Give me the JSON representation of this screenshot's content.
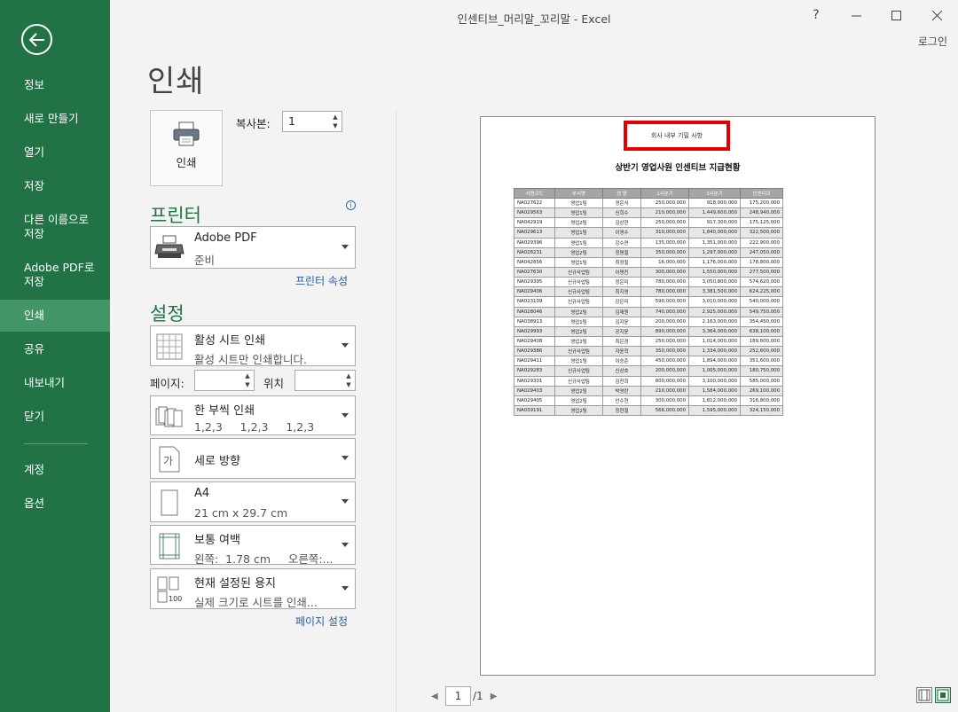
{
  "window": {
    "title": "인센티브_머리말_꼬리말 - Excel",
    "help": "?",
    "minimize": "—",
    "maximize": "☐",
    "close": "✕",
    "login": "로그인"
  },
  "sidebar": {
    "back_icon": "arrow-left-icon",
    "items": [
      {
        "label": "정보"
      },
      {
        "label": "새로 만들기"
      },
      {
        "label": "열기"
      },
      {
        "label": "저장"
      },
      {
        "label": "다른 이름으로\n저장"
      },
      {
        "label": "Adobe PDF로\n저장"
      },
      {
        "label": "인쇄",
        "active": true
      },
      {
        "label": "공유"
      },
      {
        "label": "내보내기"
      },
      {
        "label": "닫기"
      },
      {
        "label": "계정"
      },
      {
        "label": "옵션"
      }
    ]
  },
  "print": {
    "page_title": "인쇄",
    "print_button": "인쇄",
    "copies_label": "복사본:",
    "copies_value": "1",
    "printer_heading": "프린터",
    "printer_name": "Adobe PDF",
    "printer_status": "준비",
    "printer_props": "프린터 속성",
    "settings_heading": "설정",
    "scope_title": "활성 시트 인쇄",
    "scope_sub": "활성 시트만 인쇄합니다.",
    "pages_label": "페이지:",
    "to_label": "위치",
    "collate_title": "한 부씩 인쇄",
    "collate_sub": "1,2,3     1,2,3     1,2,3",
    "orientation": "세로 방향",
    "paper_title": "A4",
    "paper_sub": "21 cm x 29.7 cm",
    "margin_title": "보통 여백",
    "margin_sub": "왼쪽:  1.78 cm     오른쪽:...",
    "scale_title": "현재 설정된 용지",
    "scale_sub": "실제 크기로 시트를 인쇄...",
    "page_setup": "페이지 설정"
  },
  "preview": {
    "header_text": "회사 내부 기밀 사항",
    "title": "상반기 영업사원 인센티브 지급현황",
    "columns": [
      "사원코드",
      "부서명",
      "성 명",
      "1사분기",
      "2사분기",
      "인센티브"
    ],
    "rows": [
      [
        "NA027622",
        "영업1팀",
        "경은식",
        "250,000,000",
        "918,000,000",
        "175,200,000"
      ],
      [
        "NA029563",
        "영업1팀",
        "신희수",
        "210,000,000",
        "1,449,600,000",
        "248,940,000"
      ],
      [
        "NA042919",
        "영업2팀",
        "김상현",
        "250,000,000",
        "917,300,000",
        "175,125,000"
      ],
      [
        "NA029613",
        "영업1팀",
        "이영수",
        "310,000,000",
        "1,840,000,000",
        "322,500,000"
      ],
      [
        "NA029396",
        "영업1팀",
        "강수연",
        "135,000,000",
        "1,351,000,000",
        "222,900,000"
      ],
      [
        "NA028231",
        "영업2팀",
        "정명철",
        "350,000,000",
        "1,297,000,000",
        "247,050,000"
      ],
      [
        "NA042856",
        "영업1팀",
        "최정철",
        "16,000,000",
        "1,176,000,000",
        "178,800,000"
      ],
      [
        "NA027630",
        "신규사업팀",
        "이명진",
        "300,000,000",
        "1,550,000,000",
        "277,500,000"
      ],
      [
        "NA029395",
        "신규사업팀",
        "정은미",
        "780,000,000",
        "3,050,800,000",
        "574,620,000"
      ],
      [
        "NA029406",
        "신규사업팀",
        "최지영",
        "780,000,000",
        "3,381,500,000",
        "624,225,000"
      ],
      [
        "NA023109",
        "신규사업팀",
        "강은미",
        "590,000,000",
        "3,010,000,000",
        "540,000,000"
      ],
      [
        "NA028046",
        "영업2팀",
        "김재원",
        "740,000,000",
        "2,925,000,000",
        "549,750,000"
      ],
      [
        "NA038913",
        "영업1팀",
        "김지윤",
        "200,000,000",
        "2,163,000,000",
        "354,450,000"
      ],
      [
        "NA029993",
        "영업2팀",
        "공지윤",
        "890,000,000",
        "3,364,000,000",
        "638,100,000"
      ],
      [
        "NA029408",
        "영업2팀",
        "최은경",
        "250,000,000",
        "1,014,000,000",
        "189,600,000"
      ],
      [
        "NA029386",
        "신규사업팀",
        "자윤혁",
        "350,000,000",
        "1,334,000,000",
        "252,600,000"
      ],
      [
        "NA029411",
        "영업1팀",
        "이승준",
        "450,000,000",
        "1,894,000,000",
        "351,600,000"
      ],
      [
        "NA029283",
        "신규사업팀",
        "신상호",
        "200,000,000",
        "1,005,000,000",
        "180,750,000"
      ],
      [
        "NA029301",
        "신규사업팀",
        "김진희",
        "800,000,000",
        "3,100,000,000",
        "585,000,000"
      ],
      [
        "NA029403",
        "영업2팀",
        "박영란",
        "210,000,000",
        "1,584,000,000",
        "269,100,000"
      ],
      [
        "NA029405",
        "영업2팀",
        "안수현",
        "300,000,000",
        "1,812,000,000",
        "316,800,000"
      ],
      [
        "NA039191",
        "영업2팀",
        "정현철",
        "566,000,000",
        "1,595,000,000",
        "324,150,000"
      ]
    ],
    "page_current": "1",
    "page_total": "/1"
  }
}
